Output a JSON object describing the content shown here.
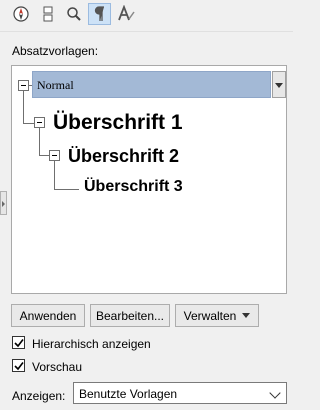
{
  "toolbar": {
    "icons": [
      "navigator-icon",
      "page-layout-icon",
      "zoom-icon",
      "paragraph-styles-icon",
      "character-styles-icon"
    ],
    "active": "paragraph-styles-icon"
  },
  "panel": {
    "styles_label": "Absatzvorlagen:"
  },
  "tree": [
    {
      "label": "Normal",
      "level": 0,
      "selected": true
    },
    {
      "label": "Überschrift 1",
      "level": 1
    },
    {
      "label": "Überschrift 2",
      "level": 2
    },
    {
      "label": "Überschrift 3",
      "level": 3
    }
  ],
  "buttons": {
    "apply": "Anwenden",
    "edit": "Bearbeiten...",
    "manage": "Verwalten"
  },
  "options": {
    "hierarchical": {
      "label": "Hierarchisch anzeigen",
      "checked": true
    },
    "preview": {
      "label": "Vorschau",
      "checked": true
    }
  },
  "show": {
    "label": "Anzeigen:",
    "value": "Benutzte Vorlagen"
  },
  "colors": {
    "selection": "#a3b9d6",
    "active_tool": "#cde2f7",
    "navigator_red": "#c0392b"
  }
}
